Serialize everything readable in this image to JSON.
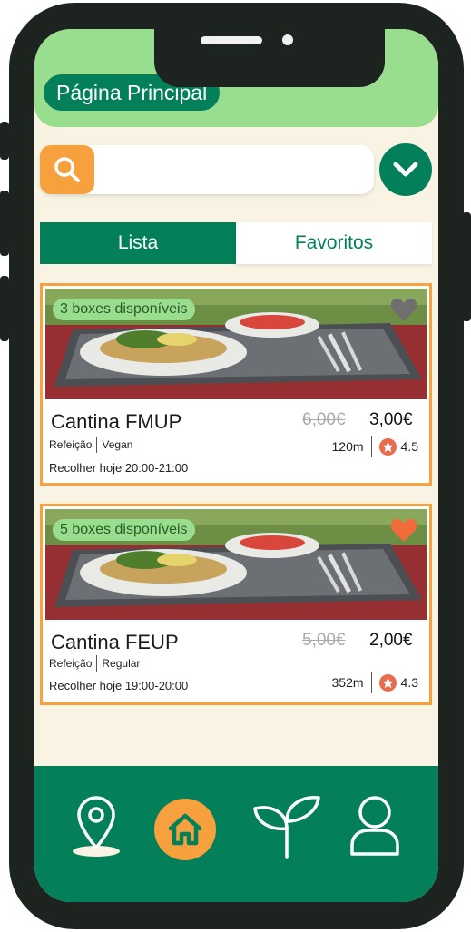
{
  "header": {
    "title": "Página Principal"
  },
  "search": {
    "placeholder": "",
    "value": "",
    "icon": "search-icon"
  },
  "filter": {
    "icon": "chevron-down-icon"
  },
  "tabs": [
    {
      "label": "Lista",
      "active": true
    },
    {
      "label": "Favoritos",
      "active": false
    }
  ],
  "cards": [
    {
      "badge": "3 boxes disponíveis",
      "name": "Cantina FMUP",
      "old_price": "6,00€",
      "price": "3,00€",
      "tag1": "Refeição",
      "tag2": "Vegan",
      "pickup": "Recolher hoje 20:00-21:00",
      "distance": "120m",
      "rating": "4.5",
      "favorite": false
    },
    {
      "badge": "5 boxes disponíveis",
      "name": "Cantina FEUP",
      "old_price": "5,00€",
      "price": "2,00€",
      "tag1": "Refeição",
      "tag2": "Regular",
      "pickup": "Recolher hoje 19:00-20:00",
      "distance": "352m",
      "rating": "4.3",
      "favorite": true
    }
  ],
  "nav": {
    "items": [
      {
        "icon": "map-pin-icon"
      },
      {
        "icon": "home-icon",
        "active": true
      },
      {
        "icon": "sprout-icon"
      },
      {
        "icon": "user-icon"
      }
    ]
  },
  "colors": {
    "brand_green": "#03805a",
    "light_green": "#99dd8e",
    "accent_orange": "#f6a03e",
    "background": "#f8f3e3",
    "heart_active": "#f26b3a",
    "heart_inactive": "#6f6f6f"
  }
}
